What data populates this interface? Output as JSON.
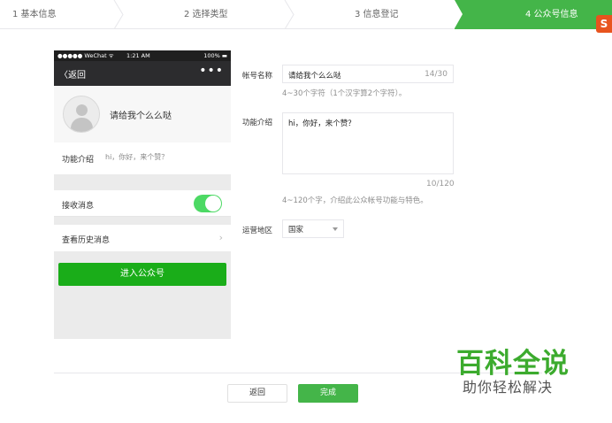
{
  "steps": {
    "items": [
      "1 基本信息",
      "2 选择类型",
      "3 信息登记"
    ],
    "active": "4 公众号信息"
  },
  "phone": {
    "carrier": "●●●●● WeChat ᯤ",
    "time": "1:21 AM",
    "battery": "100% ▬",
    "back": "〈返回",
    "more": "•••",
    "name": "请给我个么么哒",
    "intro_label": "功能介绍",
    "intro_value": "hi，你好，来个赞？",
    "receive_label": "接收消息",
    "receive_enabled": true,
    "history_label": "查看历史消息",
    "history_arrow": "›",
    "enter_button": "进入公众号"
  },
  "form": {
    "name_label": "帐号名称",
    "name_value": "请给我个么么哒",
    "name_count": "14/30",
    "name_hint": "4~30个字符（1个汉字算2个字符）。",
    "intro_label": "功能介绍",
    "intro_value": "hi，你好，来个赞？",
    "intro_count": "10/120",
    "intro_hint": "4~120个字，介绍此公众帐号功能与特色。",
    "region_label": "运营地区",
    "region_value": "国家"
  },
  "buttons": {
    "back": "返回",
    "done": "完成"
  },
  "watermark": {
    "logo": "S",
    "title": "百科全说",
    "subtitle": "助你轻松解决"
  },
  "colors": {
    "accent": "#44b549",
    "wechat_green": "#1aad19"
  }
}
